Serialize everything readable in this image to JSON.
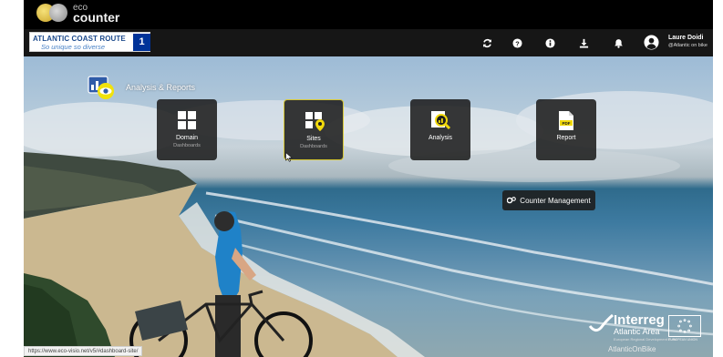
{
  "logo": {
    "line1": "eco",
    "line2": "counter"
  },
  "brand": {
    "title": "ATLANTIC COAST ROUTE",
    "subtitle": "So unique so diverse",
    "badge": "1"
  },
  "navbar": {
    "icons": [
      "refresh-icon",
      "help-icon",
      "info-icon",
      "download-icon",
      "bell-icon"
    ],
    "user": {
      "name": "Laure Doidi",
      "org": "@Atlantic on bike"
    }
  },
  "section": {
    "title": "Analysis & Reports"
  },
  "tiles": [
    {
      "label": "Domain",
      "sub": "Dashboards",
      "icon": "domain-dashboard-icon"
    },
    {
      "label": "Sites",
      "sub": "Dashboards",
      "icon": "sites-dashboard-icon",
      "active": true
    },
    {
      "label": "Analysis",
      "sub": "",
      "icon": "analysis-icon"
    },
    {
      "label": "Report",
      "sub": "",
      "icon": "pdf-report-icon"
    }
  ],
  "counter_management": {
    "label": "Counter Management"
  },
  "status_bar": {
    "url": "https://www.eco-visio.net/v5/#dashboard-site/"
  },
  "interreg": {
    "title": "Interreg",
    "subtitle": "Atlantic Area",
    "fine": "European Regional Development Fund",
    "footer": "AtlanticOnBike",
    "eu_caption": "EUROPEAN UNION"
  },
  "colors": {
    "accent": "#d8c836",
    "navbar": "#161616",
    "brand_blue": "#1c4a8c",
    "eu_blue": "#003399"
  }
}
